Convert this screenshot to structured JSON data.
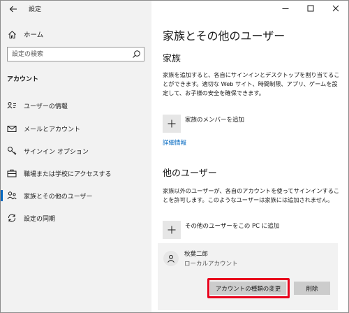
{
  "window": {
    "app_title": "設定",
    "controls": {
      "minimize": "minimize-icon",
      "maximize": "maximize-icon",
      "close": "close-icon"
    }
  },
  "sidebar": {
    "home_label": "ホーム",
    "search_placeholder": "設定の検索",
    "section_label": "アカウント",
    "items": [
      {
        "label": "ユーザーの情報",
        "icon": "user-info-icon"
      },
      {
        "label": "メールとアカウント",
        "icon": "mail-icon"
      },
      {
        "label": "サインイン オプション",
        "icon": "key-icon"
      },
      {
        "label": "職場または学校にアクセスする",
        "icon": "briefcase-icon"
      },
      {
        "label": "家族とその他のユーザー",
        "icon": "family-icon",
        "selected": true
      },
      {
        "label": "設定の同期",
        "icon": "sync-icon"
      }
    ]
  },
  "main": {
    "page_title": "家族とその他のユーザー",
    "family": {
      "heading": "家族",
      "description": "家族を追加すると、各自にサインインとデスクトップを割り当てることができます。適切な Web サイト、時間制限、アプリ、ゲームを設定して、お子様の安全を確保できます。",
      "add_label": "家族のメンバーを追加",
      "more_info_link": "詳細情報"
    },
    "other_users": {
      "heading": "他のユーザー",
      "description": "家族以外のユーザーが、各自のアカウントを使ってサインインすることを許可します。このようなユーザーは家族には追加されません。",
      "add_label": "その他のユーザーをこの PC に追加",
      "user": {
        "name": "秋葉二郎",
        "type": "ローカルアカウント"
      },
      "change_type_button": "アカウントの種類の変更",
      "delete_button": "削除"
    }
  },
  "colors": {
    "accent": "#0067c0",
    "highlight": "#e8001c",
    "sidebar_bg": "#f2f2f2",
    "button_bg": "#cccccc"
  }
}
